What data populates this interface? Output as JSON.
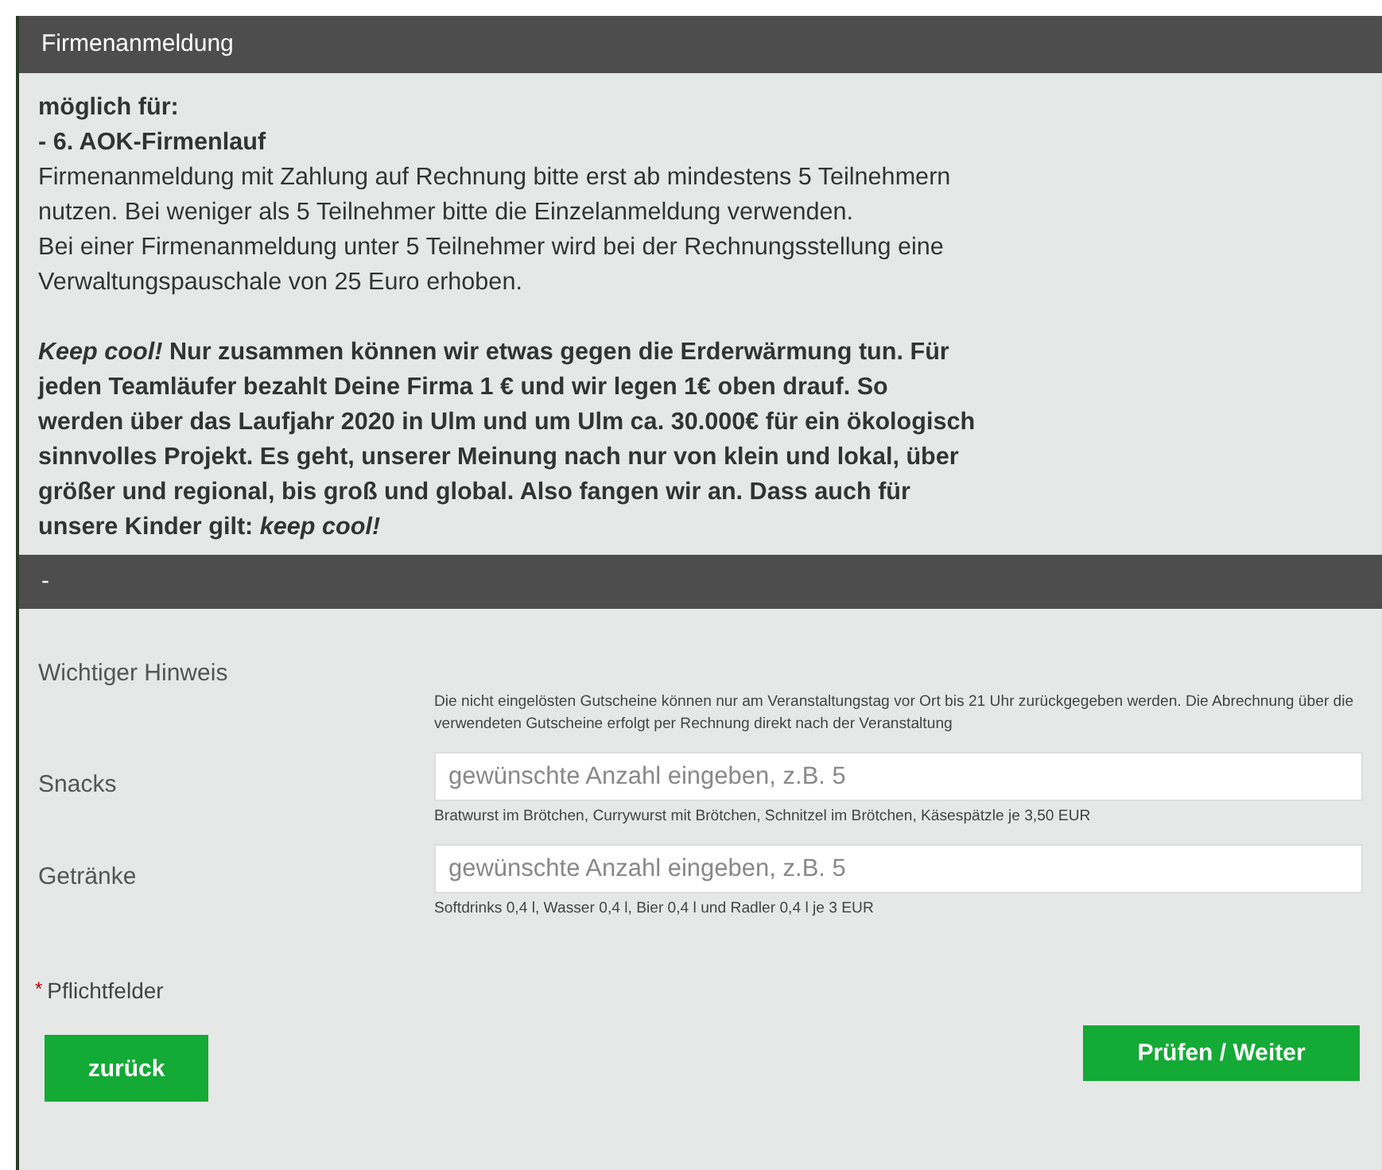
{
  "header": {
    "title": "Firmenanmeldung"
  },
  "intro": {
    "paragraphs": [
      {
        "kind": "plain",
        "text": "**möglich für:**\n**- 6. AOK-Firmenlauf**\nFirmenanmeldung mit Zahlung auf Rechnung bitte erst ab mindestens 5 Teilnehmern\nnutzen. Bei weniger als 5 Teilnehmer bitte die Einzelanmeldung verwenden.\nBei einer Firmenanmeldung unter 5 Teilnehmer wird bei der Rechnungsstellung eine\nVerwaltungspauschale von 25 Euro erhoben."
      },
      {
        "kind": "bold",
        "text": "*Keep cool!* Nur zusammen können wir etwas gegen die Erderwärmung tun. Für\njeden Teamläufer bezahlt Deine Firma 1 € und wir legen 1€ oben drauf. So\nwerden über das Laufjahr 2020 in Ulm und um Ulm ca. 30.000€ für ein ökologisch\nsinnvolles Projekt. Es geht, unserer Meinung nach nur von klein und lokal, über\ngrößer und regional, bis groß und global. Also fangen wir an. Dass auch für\nunsere Kinder gilt: *keep cool!*"
      }
    ]
  },
  "section": {
    "title": "-"
  },
  "form": {
    "rows": [
      {
        "kind": "note",
        "label": "Wichtiger Hinweis",
        "help": "Die nicht eingelösten Gutscheine können nur am Veranstaltungstag vor Ort bis 21 Uhr zurückgegeben werden. Die Abrechnung über die verwendeten Gutscheine erfolgt per Rechnung direkt nach der Veranstaltung"
      },
      {
        "kind": "input",
        "label": "Snacks",
        "placeholder": "gewünschte Anzahl eingeben, z.B. 5",
        "help": "Bratwurst im Brötchen, Currywurst mit Brötchen, Schnitzel im Brötchen, Käsespätzle je 3,50 EUR"
      },
      {
        "kind": "input",
        "label": "Getränke",
        "placeholder": "gewünschte Anzahl eingeben, z.B. 5",
        "help": "Softdrinks 0,4 l, Wasser 0,4 l, Bier 0,4 l und Radler 0,4 l je 3 EUR"
      }
    ]
  },
  "required": {
    "mark": "*",
    "label": "Pflichtfelder"
  },
  "buttons": {
    "back": "zurück",
    "next": "Prüfen / Weiter"
  }
}
